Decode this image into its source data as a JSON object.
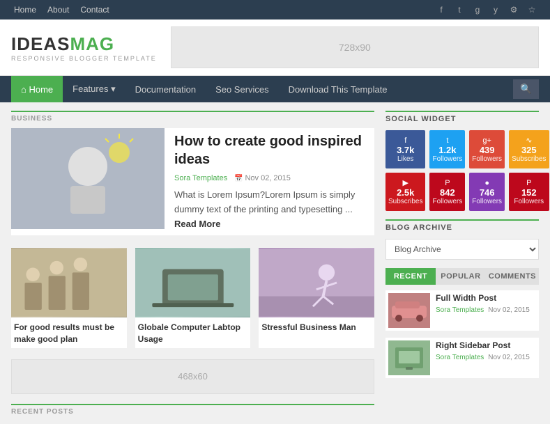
{
  "topnav": {
    "links": [
      {
        "label": "Home",
        "active": false
      },
      {
        "label": "About",
        "active": false
      },
      {
        "label": "Contact",
        "active": false
      }
    ],
    "icons": [
      "fb-icon",
      "tw-icon",
      "gp-icon",
      "yt-icon",
      "settings-icon",
      "globe-icon"
    ]
  },
  "header": {
    "logo_ideas": "IDEAS",
    "logo_mag": "MAG",
    "logo_sub": "RESPONSIVE BLOGGER TEMPLATE",
    "ad_label": "728x90"
  },
  "mainnav": {
    "items": [
      {
        "label": "⌂ Home",
        "active": true
      },
      {
        "label": "Features ▾",
        "active": false
      },
      {
        "label": "Documentation",
        "active": false
      },
      {
        "label": "Seo Services",
        "active": false
      },
      {
        "label": "Download This Template",
        "active": false
      }
    ]
  },
  "main": {
    "section_label": "BUSINESS",
    "featured": {
      "title": "How to create good inspired ideas",
      "author": "Sora Templates",
      "date": "Nov 02, 2015",
      "excerpt": "What is Lorem Ipsum?Lorem Ipsum is simply dummy text of the printing and typesetting ...",
      "read_more": "Read More"
    },
    "grid_posts": [
      {
        "title": "For good results must be make good plan"
      },
      {
        "title": "Globale Computer Labtop Usage"
      },
      {
        "title": "Stressful Business Man"
      }
    ],
    "ad2_label": "468x60",
    "recent_label": "RECENT POSTS"
  },
  "sidebar": {
    "social_title": "SOCIAL WIDGET",
    "social": [
      {
        "platform": "fb",
        "count": "3.7k",
        "label": "Likes",
        "css": "fb"
      },
      {
        "platform": "tw",
        "count": "1.2k",
        "label": "Followers",
        "css": "tw"
      },
      {
        "platform": "gp",
        "count": "439",
        "label": "Followers",
        "css": "gp"
      },
      {
        "platform": "rss",
        "count": "325",
        "label": "Subscribes",
        "css": "rss"
      },
      {
        "platform": "yt",
        "count": "2.5k",
        "label": "Subscribes",
        "css": "yt"
      },
      {
        "platform": "pi",
        "count": "842",
        "label": "Followers",
        "css": "pi"
      },
      {
        "platform": "ig",
        "count": "746",
        "label": "Followers",
        "css": "ig"
      },
      {
        "platform": "pt",
        "count": "152",
        "label": "Followers",
        "css": "pt"
      }
    ],
    "archive_title": "BLOG ARCHIVE",
    "archive_placeholder": "Blog Archive",
    "tabs": [
      {
        "label": "RECENT",
        "active": true
      },
      {
        "label": "POPULAR",
        "active": false
      },
      {
        "label": "COMMENTS",
        "active": false
      }
    ],
    "recent_posts": [
      {
        "title": "Full Width Post",
        "author": "Sora Templates",
        "date": "Nov 02, 2015"
      },
      {
        "title": "Right Sidebar Post",
        "author": "Sora Templates",
        "date": "Nov 02, 2015"
      }
    ]
  }
}
